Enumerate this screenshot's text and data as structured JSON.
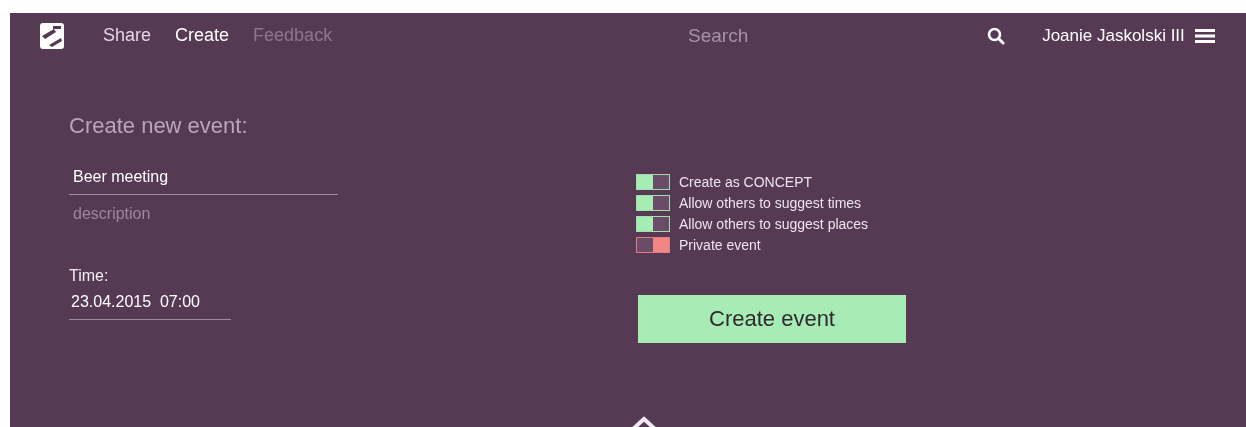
{
  "nav": {
    "links": [
      {
        "label": "Share",
        "selected": false,
        "disabled": false
      },
      {
        "label": "Create",
        "selected": true,
        "disabled": false
      },
      {
        "label": "Feedback",
        "selected": false,
        "disabled": true
      }
    ],
    "search": {
      "placeholder": "Search"
    },
    "user": "Joanie Jaskolski III"
  },
  "form": {
    "heading": "Create new event:",
    "title_field": {
      "value": "Beer meeting"
    },
    "description_field": {
      "placeholder": "description"
    },
    "time_label": "Time:",
    "time_field": {
      "value": "23.04.2015  07:00"
    },
    "options": [
      {
        "label": "Create as CONCEPT",
        "on": true
      },
      {
        "label": "Allow others to suggest times",
        "on": true
      },
      {
        "label": "Allow others to suggest places",
        "on": true
      },
      {
        "label": "Private event",
        "on": false
      }
    ],
    "submit": "Create event"
  }
}
